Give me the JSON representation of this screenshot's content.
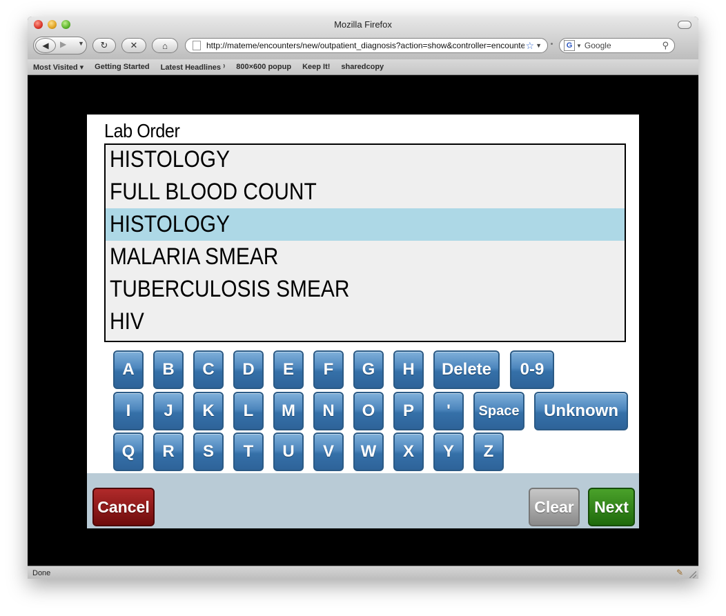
{
  "window": {
    "title": "Mozilla Firefox"
  },
  "toolbar": {
    "url": "http://mateme/encounters/new/outpatient_diagnosis?action=show&controller=encounters",
    "search_placeholder": "Google",
    "engine_letter": "G"
  },
  "bookmarks": [
    "Most Visited ▾",
    "Getting Started",
    "Latest Headlines ⁾",
    "800×600 popup",
    "Keep It!",
    "sharedcopy"
  ],
  "form": {
    "helper_text": "Lab Order",
    "input_value": "HISTOLOGY",
    "options": [
      "FULL BLOOD COUNT",
      "HISTOLOGY",
      "MALARIA SMEAR",
      "TUBERCULOSIS SMEAR",
      "HIV"
    ],
    "selected_index": 1
  },
  "keyboard": {
    "row1": [
      "A",
      "B",
      "C",
      "D",
      "E",
      "F",
      "G",
      "H",
      "Delete",
      "0-9"
    ],
    "row2": [
      "I",
      "J",
      "K",
      "L",
      "M",
      "N",
      "O",
      "P",
      "'",
      "Space",
      "Unknown"
    ],
    "row3": [
      "Q",
      "R",
      "S",
      "T",
      "U",
      "V",
      "W",
      "X",
      "Y",
      "Z"
    ]
  },
  "buttons": {
    "cancel": "Cancel",
    "clear": "Clear",
    "next": "Next"
  },
  "status": {
    "text": "Done"
  },
  "colors": {
    "key_blue": "#3570a8",
    "selected_row": "#add8e6",
    "cancel_red": "#8b1a1a",
    "next_green": "#2f7d12",
    "button_bar": "#b9cbd6"
  }
}
